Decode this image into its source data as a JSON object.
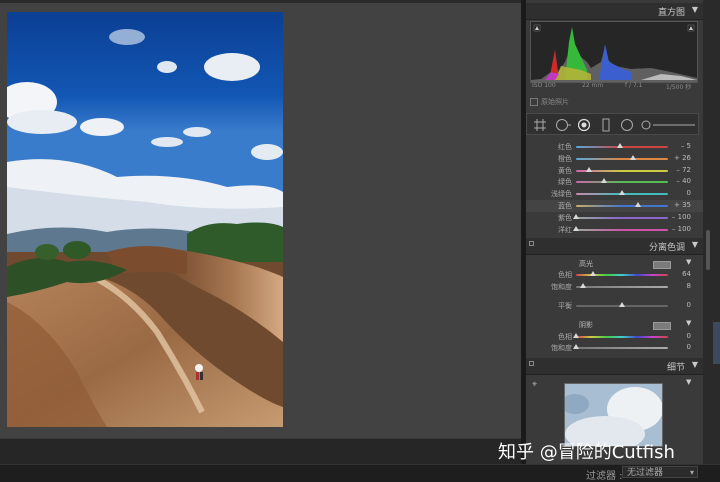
{
  "histogram": {
    "title": "直方图",
    "iso": "ISO 100",
    "focal": "22 mm",
    "aperture": "f / 7.1",
    "shutter": "1/500 秒",
    "original_photo_label": "原始照片"
  },
  "hsl": {
    "rows": [
      {
        "label": "红色",
        "value": "– 5",
        "pos": 0.48,
        "grad": "linear-gradient(90deg,#5ad,#c44,#c44)"
      },
      {
        "label": "橙色",
        "value": "+ 26",
        "pos": 0.62,
        "grad": "linear-gradient(90deg,#5ad,#d84,#d84)"
      },
      {
        "label": "黄色",
        "value": "– 72",
        "pos": 0.14,
        "grad": "linear-gradient(90deg,#c6a,#cc4,#cc4)"
      },
      {
        "label": "绿色",
        "value": "– 40",
        "pos": 0.3,
        "grad": "linear-gradient(90deg,#c6a,#5b5,#5b5)"
      },
      {
        "label": "浅绿色",
        "value": "0",
        "pos": 0.5,
        "grad": "linear-gradient(90deg,#c8a,#4bb,#4bb)"
      },
      {
        "label": "蓝色",
        "value": "+ 35",
        "pos": 0.67,
        "grad": "linear-gradient(90deg,#ca6,#47c,#47c)",
        "active": true
      },
      {
        "label": "紫色",
        "value": "– 100",
        "pos": 0.0,
        "grad": "linear-gradient(90deg,#9a9,#86c,#86c)"
      },
      {
        "label": "洋红",
        "value": "– 100",
        "pos": 0.0,
        "grad": "linear-gradient(90deg,#9a9,#c5a,#c5a)"
      }
    ]
  },
  "split_toning": {
    "title": "分离色调",
    "highlights_label": "高光",
    "hue_label": "色相",
    "hue_value": "64",
    "hue_pos": 0.18,
    "sat_label": "饱和度",
    "sat_value": "8",
    "sat_pos": 0.08,
    "balance_label": "平衡",
    "balance_value": "0",
    "balance_pos": 0.5,
    "shadows_label": "阴影",
    "shadow_hue_label": "色相",
    "shadow_hue_value": "0",
    "shadow_hue_pos": 0.0,
    "shadow_sat_label": "饱和度",
    "shadow_sat_value": "0",
    "shadow_sat_pos": 0.0
  },
  "detail": {
    "title": "细节"
  },
  "filter": {
    "label": "过滤器 :",
    "value": "无过滤器"
  },
  "watermark": "知乎 @冒险的Cutfish",
  "colors": {
    "panel": "#3a3a3a",
    "canvas": "#424242",
    "header": "#2f2f2f"
  }
}
